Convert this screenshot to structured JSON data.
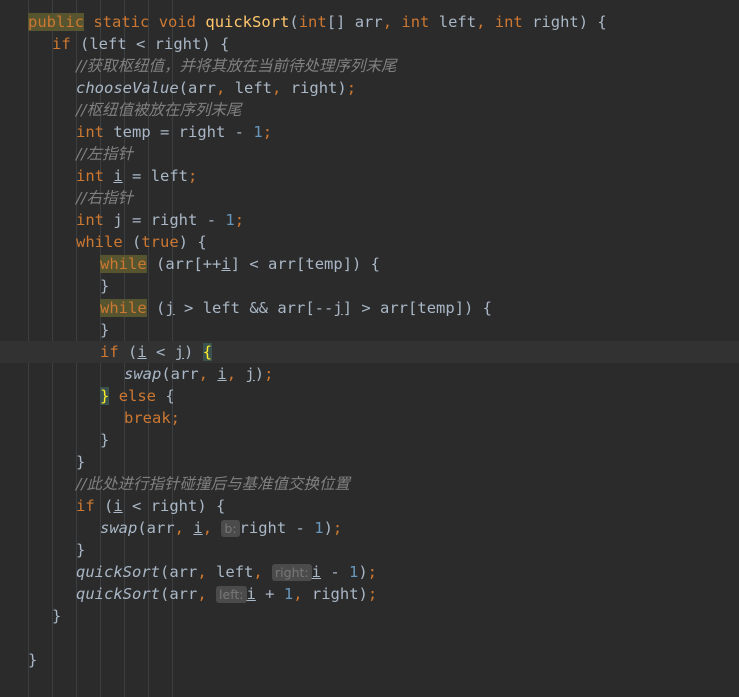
{
  "editor": {
    "app": "code-editor",
    "language": "java",
    "theme": "darcula",
    "colors": {
      "background": "#2B2B2B",
      "current_line": "#323232",
      "indent_guide": "#3C3F41",
      "default_text": "#A9B7C6",
      "keyword": "#CC7832",
      "number": "#6897BB",
      "comment": "#808080",
      "method_name": "#FFC66D",
      "search_highlight": "#56552F",
      "brace_match_fg": "#FFEF28",
      "brace_match_bg": "#3B514D",
      "param_hint_bg": "#4B4B4B",
      "param_hint_fg": "#787878"
    },
    "current_line_number": 16,
    "search_term": "while",
    "indent_guides_x": [
      28,
      52,
      76,
      100,
      124,
      148,
      172
    ]
  },
  "code": {
    "lines": [
      {
        "n": 1,
        "indent": 0,
        "current": false,
        "tokens": [
          {
            "t": "public",
            "c": "kwhl"
          },
          {
            "t": " ",
            "c": "punc"
          },
          {
            "t": "static",
            "c": "kw"
          },
          {
            "t": " ",
            "c": "punc"
          },
          {
            "t": "void",
            "c": "kw"
          },
          {
            "t": " ",
            "c": "punc"
          },
          {
            "t": "quickSort",
            "c": "mname"
          },
          {
            "t": "(",
            "c": "punc"
          },
          {
            "t": "int",
            "c": "kw"
          },
          {
            "t": "[] ",
            "c": "punc"
          },
          {
            "t": "arr",
            "c": "id"
          },
          {
            "t": ",",
            "c": "comma"
          },
          {
            "t": " ",
            "c": "punc"
          },
          {
            "t": "int",
            "c": "kw"
          },
          {
            "t": " ",
            "c": "punc"
          },
          {
            "t": "left",
            "c": "id"
          },
          {
            "t": ",",
            "c": "comma"
          },
          {
            "t": " ",
            "c": "punc"
          },
          {
            "t": "int",
            "c": "kw"
          },
          {
            "t": " ",
            "c": "punc"
          },
          {
            "t": "right",
            "c": "id"
          },
          {
            "t": ") {",
            "c": "punc"
          }
        ]
      },
      {
        "n": 2,
        "indent": 1,
        "current": false,
        "tokens": [
          {
            "t": "if",
            "c": "kw"
          },
          {
            "t": " (",
            "c": "punc"
          },
          {
            "t": "left",
            "c": "id"
          },
          {
            "t": " < ",
            "c": "punc"
          },
          {
            "t": "right",
            "c": "id"
          },
          {
            "t": ") {",
            "c": "punc"
          }
        ]
      },
      {
        "n": 3,
        "indent": 2,
        "current": false,
        "tokens": [
          {
            "t": "//获取枢纽值，并将其放在当前待处理序列末尾",
            "c": "cmt"
          }
        ]
      },
      {
        "n": 4,
        "indent": 2,
        "current": false,
        "tokens": [
          {
            "t": "chooseValue",
            "c": "call"
          },
          {
            "t": "(",
            "c": "punc"
          },
          {
            "t": "arr",
            "c": "id"
          },
          {
            "t": ",",
            "c": "comma"
          },
          {
            "t": " ",
            "c": "punc"
          },
          {
            "t": "left",
            "c": "id"
          },
          {
            "t": ",",
            "c": "comma"
          },
          {
            "t": " ",
            "c": "punc"
          },
          {
            "t": "right",
            "c": "id"
          },
          {
            "t": ")",
            "c": "punc"
          },
          {
            "t": ";",
            "c": "semi"
          }
        ]
      },
      {
        "n": 5,
        "indent": 2,
        "current": false,
        "tokens": [
          {
            "t": "//枢纽值被放在序列末尾",
            "c": "cmt"
          }
        ]
      },
      {
        "n": 6,
        "indent": 2,
        "current": false,
        "tokens": [
          {
            "t": "int",
            "c": "kw"
          },
          {
            "t": " ",
            "c": "punc"
          },
          {
            "t": "temp",
            "c": "id"
          },
          {
            "t": " = ",
            "c": "punc"
          },
          {
            "t": "right",
            "c": "id"
          },
          {
            "t": " - ",
            "c": "punc"
          },
          {
            "t": "1",
            "c": "num"
          },
          {
            "t": ";",
            "c": "semi"
          }
        ]
      },
      {
        "n": 7,
        "indent": 2,
        "current": false,
        "tokens": [
          {
            "t": "//左指针",
            "c": "cmt"
          }
        ]
      },
      {
        "n": 8,
        "indent": 2,
        "current": false,
        "tokens": [
          {
            "t": "int",
            "c": "kw"
          },
          {
            "t": " ",
            "c": "punc"
          },
          {
            "t": "i",
            "c": "fld"
          },
          {
            "t": " = ",
            "c": "punc"
          },
          {
            "t": "left",
            "c": "id"
          },
          {
            "t": ";",
            "c": "semi"
          }
        ]
      },
      {
        "n": 9,
        "indent": 2,
        "current": false,
        "tokens": [
          {
            "t": "//右指针",
            "c": "cmt"
          }
        ]
      },
      {
        "n": 10,
        "indent": 2,
        "current": false,
        "tokens": [
          {
            "t": "int",
            "c": "kw"
          },
          {
            "t": " ",
            "c": "punc"
          },
          {
            "t": "j",
            "c": "id"
          },
          {
            "t": " = ",
            "c": "punc"
          },
          {
            "t": "right",
            "c": "id"
          },
          {
            "t": " - ",
            "c": "punc"
          },
          {
            "t": "1",
            "c": "num"
          },
          {
            "t": ";",
            "c": "semi"
          }
        ]
      },
      {
        "n": 11,
        "indent": 2,
        "current": false,
        "tokens": [
          {
            "t": "while",
            "c": "kw"
          },
          {
            "t": " (",
            "c": "punc"
          },
          {
            "t": "true",
            "c": "kw"
          },
          {
            "t": ") {",
            "c": "punc"
          }
        ]
      },
      {
        "n": 12,
        "indent": 3,
        "current": false,
        "tokens": [
          {
            "t": "while",
            "c": "kwhl"
          },
          {
            "t": " (",
            "c": "punc"
          },
          {
            "t": "arr",
            "c": "id"
          },
          {
            "t": "[++",
            "c": "punc"
          },
          {
            "t": "i",
            "c": "fld"
          },
          {
            "t": "] < ",
            "c": "punc"
          },
          {
            "t": "arr",
            "c": "id"
          },
          {
            "t": "[",
            "c": "punc"
          },
          {
            "t": "temp",
            "c": "id"
          },
          {
            "t": "]) {",
            "c": "punc"
          }
        ]
      },
      {
        "n": 13,
        "indent": 3,
        "current": false,
        "tokens": [
          {
            "t": "}",
            "c": "punc"
          }
        ]
      },
      {
        "n": 14,
        "indent": 3,
        "current": false,
        "tokens": [
          {
            "t": "while",
            "c": "kwhl"
          },
          {
            "t": " (",
            "c": "punc"
          },
          {
            "t": "j",
            "c": "fld"
          },
          {
            "t": " > ",
            "c": "punc"
          },
          {
            "t": "left",
            "c": "id"
          },
          {
            "t": " && ",
            "c": "punc"
          },
          {
            "t": "arr",
            "c": "id"
          },
          {
            "t": "[--",
            "c": "punc"
          },
          {
            "t": "j",
            "c": "fld"
          },
          {
            "t": "] > ",
            "c": "punc"
          },
          {
            "t": "arr",
            "c": "id"
          },
          {
            "t": "[",
            "c": "punc"
          },
          {
            "t": "temp",
            "c": "id"
          },
          {
            "t": "]) {",
            "c": "punc"
          }
        ]
      },
      {
        "n": 15,
        "indent": 3,
        "current": false,
        "tokens": [
          {
            "t": "}",
            "c": "punc"
          }
        ]
      },
      {
        "n": 16,
        "indent": 3,
        "current": true,
        "tokens": [
          {
            "t": "if",
            "c": "kw"
          },
          {
            "t": " (",
            "c": "punc"
          },
          {
            "t": "i",
            "c": "fld"
          },
          {
            "t": " < ",
            "c": "punc"
          },
          {
            "t": "j",
            "c": "fld"
          },
          {
            "t": ") ",
            "c": "punc"
          },
          {
            "t": "{",
            "c": "brace-match"
          }
        ]
      },
      {
        "n": 17,
        "indent": 4,
        "current": false,
        "tokens": [
          {
            "t": "swap",
            "c": "call"
          },
          {
            "t": "(",
            "c": "punc"
          },
          {
            "t": "arr",
            "c": "id"
          },
          {
            "t": ",",
            "c": "comma"
          },
          {
            "t": " ",
            "c": "punc"
          },
          {
            "t": "i",
            "c": "fld"
          },
          {
            "t": ",",
            "c": "comma"
          },
          {
            "t": " ",
            "c": "punc"
          },
          {
            "t": "j",
            "c": "fld"
          },
          {
            "t": ")",
            "c": "punc"
          },
          {
            "t": ";",
            "c": "semi"
          }
        ]
      },
      {
        "n": 18,
        "indent": 3,
        "current": false,
        "tokens": [
          {
            "t": "}",
            "c": "brace-match"
          },
          {
            "t": " ",
            "c": "punc"
          },
          {
            "t": "else",
            "c": "kw"
          },
          {
            "t": " {",
            "c": "punc"
          }
        ]
      },
      {
        "n": 19,
        "indent": 4,
        "current": false,
        "tokens": [
          {
            "t": "break",
            "c": "kw"
          },
          {
            "t": ";",
            "c": "semi"
          }
        ]
      },
      {
        "n": 20,
        "indent": 3,
        "current": false,
        "tokens": [
          {
            "t": "}",
            "c": "punc"
          }
        ]
      },
      {
        "n": 21,
        "indent": 2,
        "current": false,
        "tokens": [
          {
            "t": "}",
            "c": "punc"
          }
        ]
      },
      {
        "n": 22,
        "indent": 2,
        "current": false,
        "tokens": [
          {
            "t": "//此处进行指针碰撞后与基准值交换位置",
            "c": "cmt"
          }
        ]
      },
      {
        "n": 23,
        "indent": 2,
        "current": false,
        "tokens": [
          {
            "t": "if",
            "c": "kw"
          },
          {
            "t": " (",
            "c": "punc"
          },
          {
            "t": "i",
            "c": "fld"
          },
          {
            "t": " < ",
            "c": "punc"
          },
          {
            "t": "right",
            "c": "id"
          },
          {
            "t": ") {",
            "c": "punc"
          }
        ]
      },
      {
        "n": 24,
        "indent": 3,
        "current": false,
        "tokens": [
          {
            "t": "swap",
            "c": "call"
          },
          {
            "t": "(",
            "c": "punc"
          },
          {
            "t": "arr",
            "c": "id"
          },
          {
            "t": ",",
            "c": "comma"
          },
          {
            "t": " ",
            "c": "punc"
          },
          {
            "t": "i",
            "c": "fld"
          },
          {
            "t": ",",
            "c": "comma"
          },
          {
            "t": " ",
            "c": "punc"
          },
          {
            "t": "b:",
            "c": "hint"
          },
          {
            "t": "right",
            "c": "id"
          },
          {
            "t": " - ",
            "c": "punc"
          },
          {
            "t": "1",
            "c": "num"
          },
          {
            "t": ")",
            "c": "punc"
          },
          {
            "t": ";",
            "c": "semi"
          }
        ]
      },
      {
        "n": 25,
        "indent": 2,
        "current": false,
        "tokens": [
          {
            "t": "}",
            "c": "punc"
          }
        ]
      },
      {
        "n": 26,
        "indent": 2,
        "current": false,
        "tokens": [
          {
            "t": "quickSort",
            "c": "call"
          },
          {
            "t": "(",
            "c": "punc"
          },
          {
            "t": "arr",
            "c": "id"
          },
          {
            "t": ",",
            "c": "comma"
          },
          {
            "t": " ",
            "c": "punc"
          },
          {
            "t": "left",
            "c": "id"
          },
          {
            "t": ",",
            "c": "comma"
          },
          {
            "t": " ",
            "c": "punc"
          },
          {
            "t": "right:",
            "c": "hint"
          },
          {
            "t": "i",
            "c": "fld"
          },
          {
            "t": " - ",
            "c": "punc"
          },
          {
            "t": "1",
            "c": "num"
          },
          {
            "t": ")",
            "c": "punc"
          },
          {
            "t": ";",
            "c": "semi"
          }
        ]
      },
      {
        "n": 27,
        "indent": 2,
        "current": false,
        "tokens": [
          {
            "t": "quickSort",
            "c": "call"
          },
          {
            "t": "(",
            "c": "punc"
          },
          {
            "t": "arr",
            "c": "id"
          },
          {
            "t": ",",
            "c": "comma"
          },
          {
            "t": " ",
            "c": "punc"
          },
          {
            "t": "left:",
            "c": "hint"
          },
          {
            "t": "i",
            "c": "fld"
          },
          {
            "t": " + ",
            "c": "punc"
          },
          {
            "t": "1",
            "c": "num"
          },
          {
            "t": ",",
            "c": "comma"
          },
          {
            "t": " ",
            "c": "punc"
          },
          {
            "t": "right",
            "c": "id"
          },
          {
            "t": ")",
            "c": "punc"
          },
          {
            "t": ";",
            "c": "semi"
          }
        ]
      },
      {
        "n": 28,
        "indent": 1,
        "current": false,
        "tokens": [
          {
            "t": "}",
            "c": "punc"
          }
        ]
      },
      {
        "n": 29,
        "indent": 0,
        "current": false,
        "tokens": []
      },
      {
        "n": 30,
        "indent": 0,
        "current": false,
        "tokens": [
          {
            "t": "}",
            "c": "punc"
          }
        ]
      }
    ]
  }
}
